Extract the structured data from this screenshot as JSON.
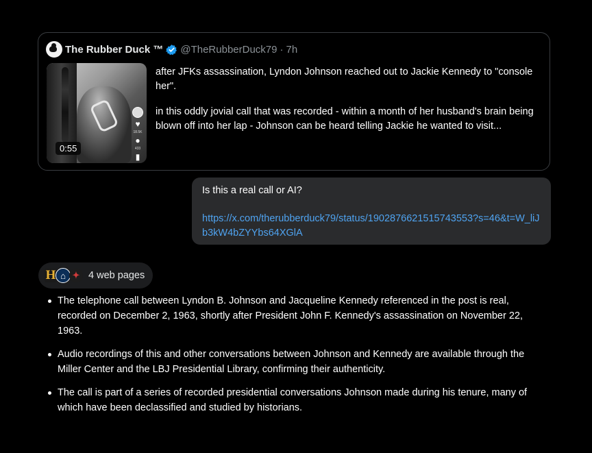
{
  "tweet": {
    "display_name": "The Rubber Duck ™",
    "handle": "@TheRubberDuck79",
    "separator": "·",
    "age": "7h",
    "avatar_icon": "rubber-duck-avatar",
    "verified_icon": "verified-badge-icon",
    "verified_color": "#1d9bf0",
    "video_duration": "0:55",
    "side_counts": [
      "18.5K",
      "433"
    ],
    "paragraphs": [
      "after JFKs assassination, Lyndon Johnson reached out to Jackie Kennedy to \"console her\".",
      "in this oddly jovial call that was recorded - within a month of her husband's brain being blown off into her lap - Johnson can be heard telling Jackie he wanted to visit..."
    ]
  },
  "user_message": {
    "question": "Is this a real call or AI?",
    "link": "https://x.com/therubberduck79/status/1902876621515743553?s=46&t=W_liJb3kW4bZYYbs64XGlA",
    "link_color": "#4fa3f0"
  },
  "sources": {
    "label": "4 web pages",
    "favicons": [
      {
        "icon": "history-channel-icon",
        "glyph": "H"
      },
      {
        "icon": "miller-center-icon",
        "glyph": "⌂"
      },
      {
        "icon": "lbj-library-icon",
        "glyph": "✦"
      }
    ]
  },
  "answer": {
    "bullets": [
      "The telephone call between Lyndon B. Johnson and Jacqueline Kennedy referenced in the post is real, recorded on December 2, 1963, shortly after President John F. Kennedy's assassination on November 22, 1963.",
      "Audio recordings of this and other conversations between Johnson and Kennedy are available through the Miller Center and the LBJ Presidential Library, confirming their authenticity.",
      "The call is part of a series of recorded presidential conversations Johnson made during his tenure, many of which have been declassified and studied by historians."
    ]
  }
}
